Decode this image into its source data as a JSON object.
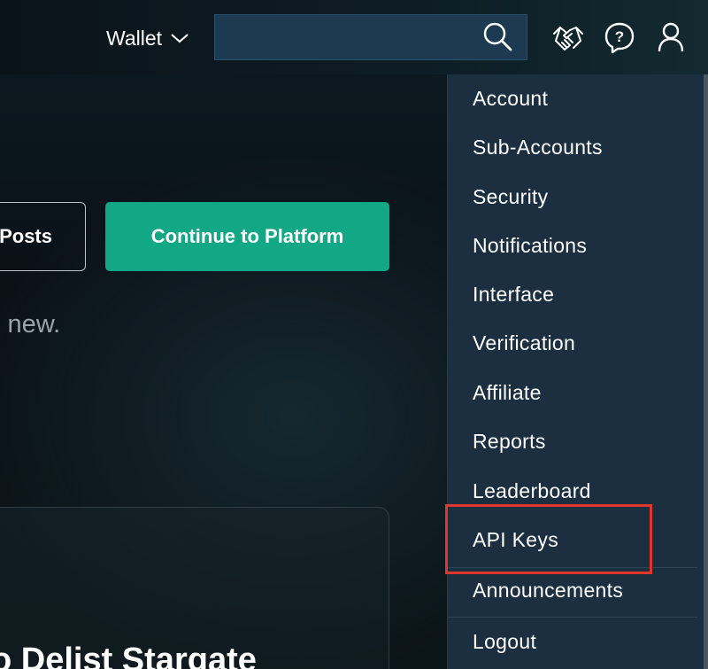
{
  "header": {
    "wallet_label": "Wallet",
    "search_placeholder": "",
    "icons": [
      "chevron-down-icon",
      "search-icon",
      "handshake-icon",
      "help-icon",
      "user-icon"
    ]
  },
  "hero": {
    "posts_button": "Posts",
    "continue_button": "Continue to Platform",
    "subtitle": "s new."
  },
  "announcement": {
    "title": "o Delist Stargate"
  },
  "account_menu": {
    "items": [
      "Account",
      "Sub-Accounts",
      "Security",
      "Notifications",
      "Interface",
      "Verification",
      "Affiliate",
      "Reports",
      "Leaderboard",
      "API Keys",
      "Announcements",
      "Logout"
    ],
    "highlighted_item": "API Keys"
  },
  "colors": {
    "accent": "#12a886",
    "menu_bg": "#1b2f41",
    "search_bg": "#1c3a52",
    "highlight": "#e0362c"
  }
}
